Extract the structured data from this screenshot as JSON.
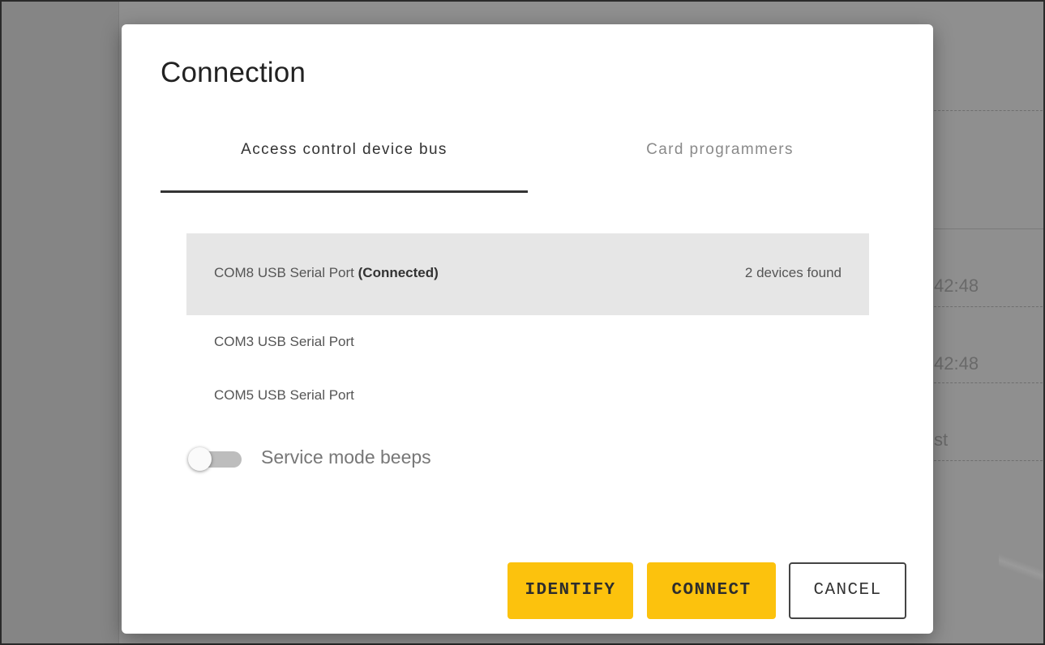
{
  "background": {
    "times": [
      "42:48",
      "42:48"
    ],
    "fragment": "st"
  },
  "dialog": {
    "title": "Connection",
    "tabs": [
      {
        "label": "Access control device bus",
        "active": true
      },
      {
        "label": "Card programmers",
        "active": false
      }
    ],
    "ports": [
      {
        "name": "COM8 USB Serial Port",
        "status": "(Connected)",
        "devices": "2 devices found",
        "selected": true
      },
      {
        "name": "COM3 USB Serial Port",
        "selected": false
      },
      {
        "name": "COM5 USB Serial Port",
        "selected": false
      }
    ],
    "service_mode": {
      "label": "Service mode beeps",
      "enabled": false
    },
    "buttons": {
      "identify": "IDENTIFY",
      "connect": "CONNECT",
      "cancel": "CANCEL"
    }
  },
  "colors": {
    "accent": "#fcc20d",
    "selected_row": "#e6e6e6",
    "overlay": "#8f8f8f"
  }
}
